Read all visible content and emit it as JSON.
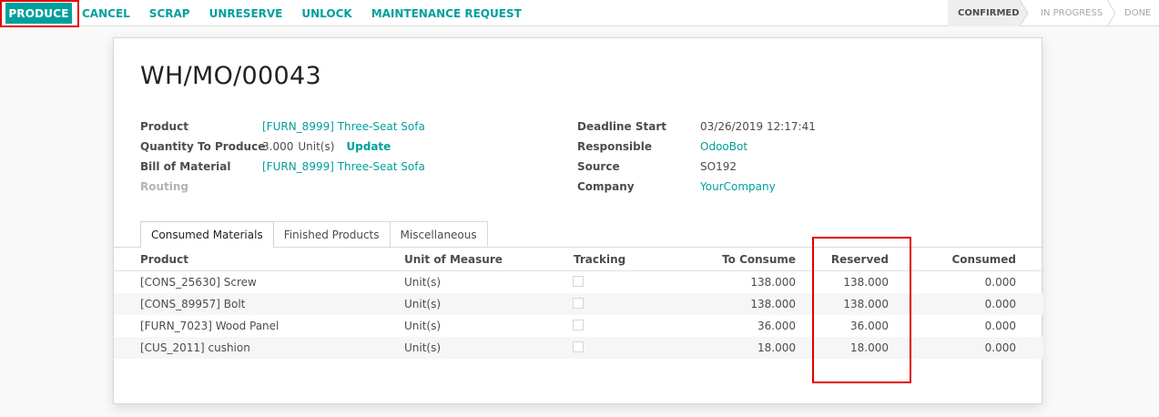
{
  "actions": {
    "produce": "PRODUCE",
    "cancel": "CANCEL",
    "scrap": "SCRAP",
    "unreserve": "UNRESERVE",
    "unlock": "UNLOCK",
    "maintenance": "MAINTENANCE REQUEST"
  },
  "stages": [
    {
      "label": "CONFIRMED",
      "active": true
    },
    {
      "label": "IN PROGRESS",
      "active": false
    },
    {
      "label": "DONE",
      "active": false
    }
  ],
  "record": {
    "title": "WH/MO/00043",
    "left_fields": [
      {
        "label": "Product",
        "value": "[FURN_8999] Three-Seat Sofa"
      },
      {
        "label": "Quantity To Produce",
        "value": "3.000",
        "unit": "Unit(s)",
        "action": "Update"
      },
      {
        "label": "Bill of Material",
        "value": "[FURN_8999] Three-Seat Sofa"
      },
      {
        "label": "Routing",
        "value": ""
      }
    ],
    "right_fields": [
      {
        "label": "Deadline Start",
        "value": "03/26/2019 12:17:41"
      },
      {
        "label": "Responsible",
        "value": "OdooBot"
      },
      {
        "label": "Source",
        "value": "SO192"
      },
      {
        "label": "Company",
        "value": "YourCompany"
      }
    ]
  },
  "tabs": [
    {
      "label": "Consumed Materials",
      "active": true
    },
    {
      "label": "Finished Products",
      "active": false
    },
    {
      "label": "Miscellaneous",
      "active": false
    }
  ],
  "table": {
    "headers": {
      "product": "Product",
      "uom": "Unit of Measure",
      "tracking": "Tracking",
      "to_consume": "To Consume",
      "reserved": "Reserved",
      "consumed": "Consumed"
    },
    "rows": [
      {
        "product": "[CONS_25630] Screw",
        "uom": "Unit(s)",
        "to_consume": "138.000",
        "reserved": "138.000",
        "consumed": "0.000"
      },
      {
        "product": "[CONS_89957] Bolt",
        "uom": "Unit(s)",
        "to_consume": "138.000",
        "reserved": "138.000",
        "consumed": "0.000"
      },
      {
        "product": "[FURN_7023] Wood Panel",
        "uom": "Unit(s)",
        "to_consume": "36.000",
        "reserved": "36.000",
        "consumed": "0.000"
      },
      {
        "product": "[CUS_2011] cushion",
        "uom": "Unit(s)",
        "to_consume": "18.000",
        "reserved": "18.000",
        "consumed": "0.000"
      }
    ]
  },
  "colors": {
    "accent": "#00a09d",
    "highlight": "#e10000"
  }
}
